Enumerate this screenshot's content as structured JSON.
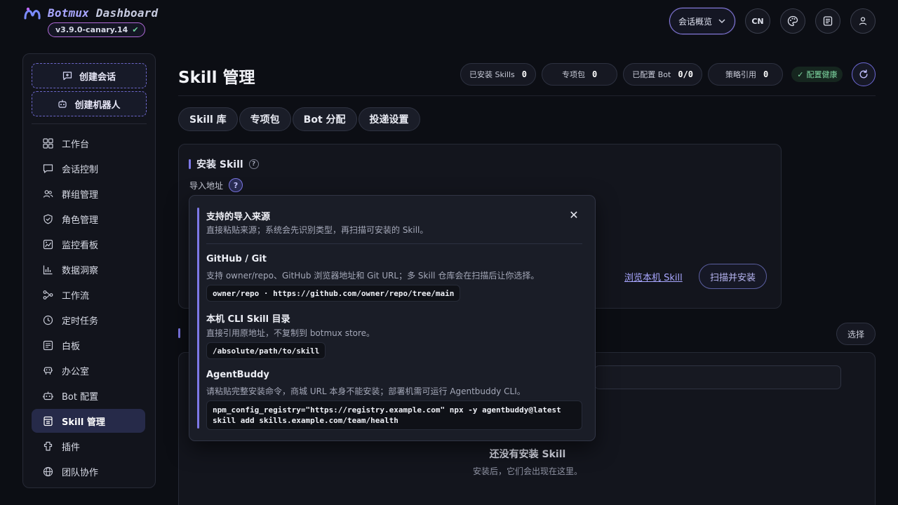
{
  "header": {
    "brand_first": "Botmux",
    "brand_rest": " Dashboard",
    "version": "v3.9.0-canary.14",
    "session_select": "会话概览",
    "lang_button": "CN"
  },
  "sidebar": {
    "create_session": "创建会话",
    "create_bot": "创建机器人",
    "items": [
      {
        "label": "工作台",
        "icon": "grid-icon"
      },
      {
        "label": "会话控制",
        "icon": "chat-icon"
      },
      {
        "label": "群组管理",
        "icon": "users-icon"
      },
      {
        "label": "角色管理",
        "icon": "shield-icon"
      },
      {
        "label": "监控看板",
        "icon": "monitor-icon"
      },
      {
        "label": "数据洞察",
        "icon": "bar-chart-icon"
      },
      {
        "label": "工作流",
        "icon": "workflow-icon"
      },
      {
        "label": "定时任务",
        "icon": "clock-icon"
      },
      {
        "label": "白板",
        "icon": "whiteboard-icon"
      },
      {
        "label": "办公室",
        "icon": "office-icon"
      },
      {
        "label": "Bot 配置",
        "icon": "bot-icon"
      },
      {
        "label": "Skill 管理",
        "icon": "skill-icon",
        "active": true
      },
      {
        "label": "插件",
        "icon": "plugin-icon"
      },
      {
        "label": "团队协作",
        "icon": "globe-icon"
      }
    ]
  },
  "main": {
    "title": "Skill 管理",
    "stats": [
      {
        "label": "已安装 Skills",
        "value": "0"
      },
      {
        "label": "专项包",
        "value": "0"
      },
      {
        "label": "已配置 Bot",
        "value": "0/0"
      },
      {
        "label": "策略引用",
        "value": "0"
      }
    ],
    "health": "配置健康",
    "tabs": [
      "Skill 库",
      "专项包",
      "Bot 分配",
      "投递设置"
    ],
    "install": {
      "title": "安装 Skill",
      "import_label": "导入地址",
      "browse_link": "浏览本机 Skill",
      "scan_button": "扫描并安装"
    },
    "installed": {
      "select_button": "选择",
      "empty_title": "还没有安装 Skill",
      "empty_sub": "安装后，它们会出现在这里。"
    }
  },
  "popover": {
    "title": "支持的导入来源",
    "desc": "直接粘贴来源；系统会先识别类型，再扫描可安装的 Skill。",
    "sources": [
      {
        "title": "GitHub / Git",
        "desc": "支持 owner/repo、GitHub 浏览器地址和 Git URL；多 Skill 仓库会在扫描后让你选择。",
        "code": "owner/repo · https://github.com/owner/repo/tree/main"
      },
      {
        "title": "本机 CLI Skill 目录",
        "desc": "直接引用原地址，不复制到 botmux store。",
        "code": "/absolute/path/to/skill"
      },
      {
        "title": "AgentBuddy",
        "desc": "请粘贴完整安装命令，商城 URL 本身不能安装；部署机需可运行 Agentbuddy CLI。",
        "code_line1": "npm_config_registry=\"https://registry.example.com\" npx -y agentbuddy@latest",
        "code_line2": "skill add skills.example.com/team/health"
      }
    ]
  },
  "colors": {
    "accent": "#7d78e6",
    "background": "#0c0e14",
    "health_green": "#7fd8a2"
  }
}
